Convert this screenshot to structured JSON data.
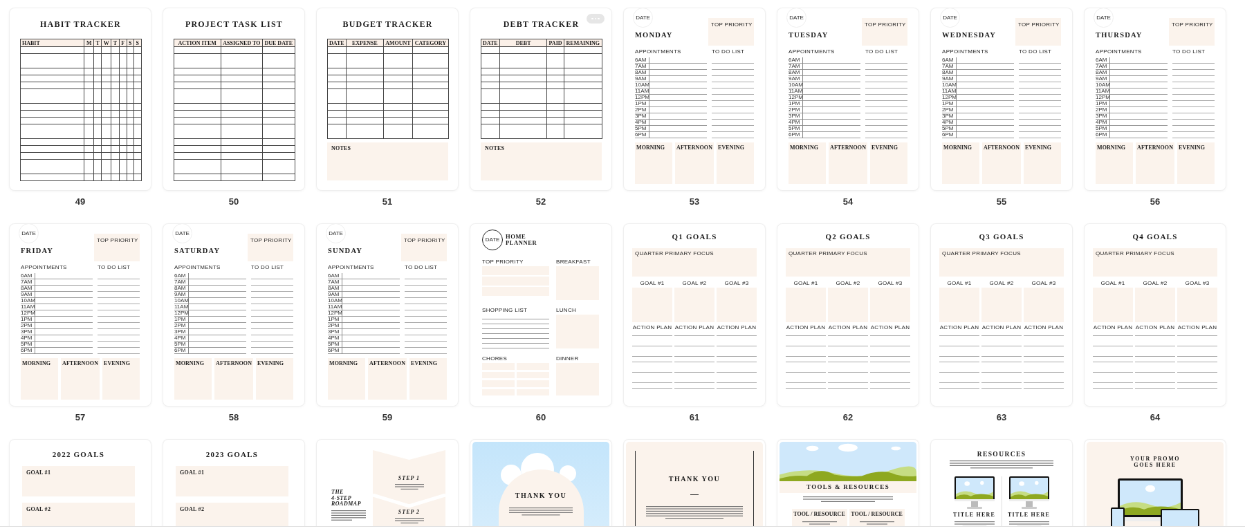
{
  "pages": [
    {
      "kind": "table",
      "number": "49",
      "hovered": false,
      "title": "HABIT TRACKER",
      "columns": [
        "HABIT",
        "M",
        "T",
        "W",
        "T",
        "F",
        "S",
        "S"
      ]
    },
    {
      "kind": "table",
      "number": "50",
      "hovered": false,
      "title": "PROJECT TASK LIST",
      "columns": [
        "ACTION ITEM",
        "ASSIGNED TO",
        "DUE DATE"
      ]
    },
    {
      "kind": "table",
      "number": "51",
      "hovered": false,
      "title": "BUDGET TRACKER",
      "columns": [
        "DATE",
        "EXPENSE",
        "AMOUNT",
        "CATEGORY"
      ],
      "notes_label": "NOTES"
    },
    {
      "kind": "table",
      "number": "52",
      "hovered": true,
      "title": "DEBT TRACKER",
      "columns": [
        "DATE",
        "DEBT",
        "PAID",
        "REMAINING"
      ],
      "notes_label": "NOTES"
    },
    {
      "kind": "daily",
      "number": "53",
      "hovered": false,
      "date_label": "DATE",
      "day": "MONDAY",
      "priority_label": "TOP PRIORITY",
      "appointments_label": "APPOINTMENTS",
      "todo_label": "TO DO LIST",
      "times": [
        "6AM",
        "7AM",
        "8AM",
        "9AM",
        "10AM",
        "11AM",
        "12PM",
        "1PM",
        "2PM",
        "3PM",
        "4PM",
        "5PM",
        "6PM"
      ],
      "sections": [
        "MORNING",
        "AFTERNOON",
        "EVENING"
      ]
    },
    {
      "kind": "daily",
      "number": "54",
      "hovered": false,
      "date_label": "DATE",
      "day": "TUESDAY",
      "priority_label": "TOP PRIORITY",
      "appointments_label": "APPOINTMENTS",
      "todo_label": "TO DO LIST",
      "times": [
        "6AM",
        "7AM",
        "8AM",
        "9AM",
        "10AM",
        "11AM",
        "12PM",
        "1PM",
        "2PM",
        "3PM",
        "4PM",
        "5PM",
        "6PM"
      ],
      "sections": [
        "MORNING",
        "AFTERNOON",
        "EVENING"
      ]
    },
    {
      "kind": "daily",
      "number": "55",
      "hovered": false,
      "date_label": "DATE",
      "day": "WEDNESDAY",
      "priority_label": "TOP PRIORITY",
      "appointments_label": "APPOINTMENTS",
      "todo_label": "TO DO LIST",
      "times": [
        "6AM",
        "7AM",
        "8AM",
        "9AM",
        "10AM",
        "11AM",
        "12PM",
        "1PM",
        "2PM",
        "3PM",
        "4PM",
        "5PM",
        "6PM"
      ],
      "sections": [
        "MORNING",
        "AFTERNOON",
        "EVENING"
      ]
    },
    {
      "kind": "daily",
      "number": "56",
      "hovered": false,
      "date_label": "DATE",
      "day": "THURSDAY",
      "priority_label": "TOP PRIORITY",
      "appointments_label": "APPOINTMENTS",
      "todo_label": "TO DO LIST",
      "times": [
        "6AM",
        "7AM",
        "8AM",
        "9AM",
        "10AM",
        "11AM",
        "12PM",
        "1PM",
        "2PM",
        "3PM",
        "4PM",
        "5PM",
        "6PM"
      ],
      "sections": [
        "MORNING",
        "AFTERNOON",
        "EVENING"
      ]
    },
    {
      "kind": "daily",
      "number": "57",
      "hovered": false,
      "date_label": "DATE",
      "day": "FRIDAY",
      "priority_label": "TOP PRIORITY",
      "appointments_label": "APPOINTMENTS",
      "todo_label": "TO DO LIST",
      "times": [
        "6AM",
        "7AM",
        "8AM",
        "9AM",
        "10AM",
        "11AM",
        "12PM",
        "1PM",
        "2PM",
        "3PM",
        "4PM",
        "5PM",
        "6PM"
      ],
      "sections": [
        "MORNING",
        "AFTERNOON",
        "EVENING"
      ]
    },
    {
      "kind": "daily",
      "number": "58",
      "hovered": false,
      "date_label": "DATE",
      "day": "SATURDAY",
      "priority_label": "TOP PRIORITY",
      "appointments_label": "APPOINTMENTS",
      "todo_label": "TO DO LIST",
      "times": [
        "6AM",
        "7AM",
        "8AM",
        "9AM",
        "10AM",
        "11AM",
        "12PM",
        "1PM",
        "2PM",
        "3PM",
        "4PM",
        "5PM",
        "6PM"
      ],
      "sections": [
        "MORNING",
        "AFTERNOON",
        "EVENING"
      ]
    },
    {
      "kind": "daily",
      "number": "59",
      "hovered": false,
      "date_label": "DATE",
      "day": "SUNDAY",
      "priority_label": "TOP PRIORITY",
      "appointments_label": "APPOINTMENTS",
      "todo_label": "TO DO LIST",
      "times": [
        "6AM",
        "7AM",
        "8AM",
        "9AM",
        "10AM",
        "11AM",
        "12PM",
        "1PM",
        "2PM",
        "3PM",
        "4PM",
        "5PM",
        "6PM"
      ],
      "sections": [
        "MORNING",
        "AFTERNOON",
        "EVENING"
      ]
    },
    {
      "kind": "home",
      "number": "60",
      "hovered": false,
      "date_label": "DATE",
      "title_lines": [
        "HOME",
        "PLANNER"
      ],
      "priority_label": "TOP PRIORITY",
      "shopping_label": "SHOPPING LIST",
      "chores_label": "CHORES",
      "meals": [
        "BREAKFAST",
        "LUNCH",
        "DINNER"
      ]
    },
    {
      "kind": "quarter",
      "number": "61",
      "hovered": false,
      "title": "Q1 GOALS",
      "focus_label": "QUARTER PRIMARY FOCUS",
      "goals": [
        "GOAL #1",
        "GOAL #2",
        "GOAL #3"
      ],
      "plan_labels": [
        "ACTION PLAN",
        "ACTION PLAN",
        "ACTION PLAN"
      ]
    },
    {
      "kind": "quarter",
      "number": "62",
      "hovered": false,
      "title": "Q2 GOALS",
      "focus_label": "QUARTER PRIMARY FOCUS",
      "goals": [
        "GOAL #1",
        "GOAL #2",
        "GOAL #3"
      ],
      "plan_labels": [
        "ACTION PLAN",
        "ACTION PLAN",
        "ACTION PLAN"
      ]
    },
    {
      "kind": "quarter",
      "number": "63",
      "hovered": false,
      "title": "Q3 GOALS",
      "focus_label": "QUARTER PRIMARY FOCUS",
      "goals": [
        "GOAL #1",
        "GOAL #2",
        "GOAL #3"
      ],
      "plan_labels": [
        "ACTION PLAN",
        "ACTION PLAN",
        "ACTION PLAN"
      ]
    },
    {
      "kind": "quarter",
      "number": "64",
      "hovered": false,
      "title": "Q4 GOALS",
      "focus_label": "QUARTER PRIMARY FOCUS",
      "goals": [
        "GOAL #1",
        "GOAL #2",
        "GOAL #3"
      ],
      "plan_labels": [
        "ACTION PLAN",
        "ACTION PLAN",
        "ACTION PLAN"
      ]
    },
    {
      "kind": "yearly",
      "hovered": false,
      "title": "2022 GOALS",
      "goals": [
        "GOAL #1",
        "GOAL #2"
      ]
    },
    {
      "kind": "yearly",
      "hovered": false,
      "title": "2023 GOALS",
      "goals": [
        "GOAL #1",
        "GOAL #2"
      ]
    },
    {
      "kind": "roadmap",
      "hovered": false,
      "title_lines": [
        "THE",
        "4-STEP",
        "ROADMAP"
      ],
      "steps": [
        "STEP 1",
        "STEP 2"
      ]
    },
    {
      "kind": "thanks_cloud",
      "hovered": false,
      "title": "THANK YOU"
    },
    {
      "kind": "thanks",
      "hovered": false,
      "title": "THANK YOU"
    },
    {
      "kind": "tools",
      "hovered": false,
      "title": "TOOLS & RESOURCES",
      "items": [
        "TOOL / RESOURCE",
        "TOOL / RESOURCE"
      ]
    },
    {
      "kind": "resources",
      "hovered": false,
      "title": "RESOURCES",
      "items": [
        "TITLE HERE",
        "TITLE HERE"
      ]
    },
    {
      "kind": "promo",
      "hovered": false,
      "title_lines": [
        "YOUR PROMO",
        "GOES HERE"
      ]
    }
  ]
}
